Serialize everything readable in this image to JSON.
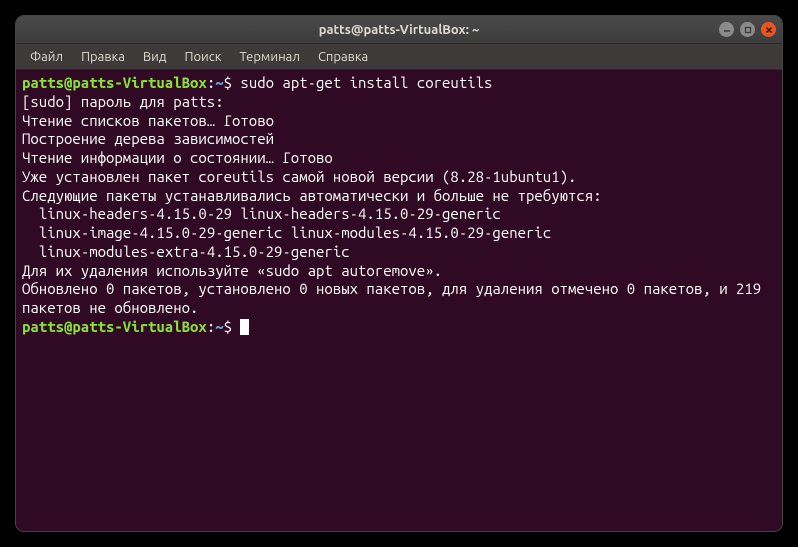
{
  "window": {
    "title": "patts@patts-VirtualBox: ~"
  },
  "menubar": {
    "items": [
      "Файл",
      "Правка",
      "Вид",
      "Поиск",
      "Терминал",
      "Справка"
    ]
  },
  "prompt": {
    "user_host": "patts@patts-VirtualBox",
    "colon": ":",
    "path": "~",
    "dollar": "$"
  },
  "terminal": {
    "command1": " sudo apt-get install coreutils",
    "lines": [
      "[sudo] пароль для patts:",
      "Чтение списков пакетов… Готово",
      "Построение дерева зависимостей",
      "Чтение информации о состоянии… Готово",
      "Уже установлен пакет coreutils самой новой версии (8.28-1ubuntu1).",
      "Следующие пакеты устанавливались автоматически и больше не требуются:",
      "  linux-headers-4.15.0-29 linux-headers-4.15.0-29-generic",
      "  linux-image-4.15.0-29-generic linux-modules-4.15.0-29-generic",
      "  linux-modules-extra-4.15.0-29-generic",
      "Для их удаления используйте «sudo apt autoremove».",
      "Обновлено 0 пакетов, установлено 0 новых пакетов, для удаления отмечено 0 пакетов, и 219 пакетов не обновлено."
    ],
    "command2": " "
  }
}
